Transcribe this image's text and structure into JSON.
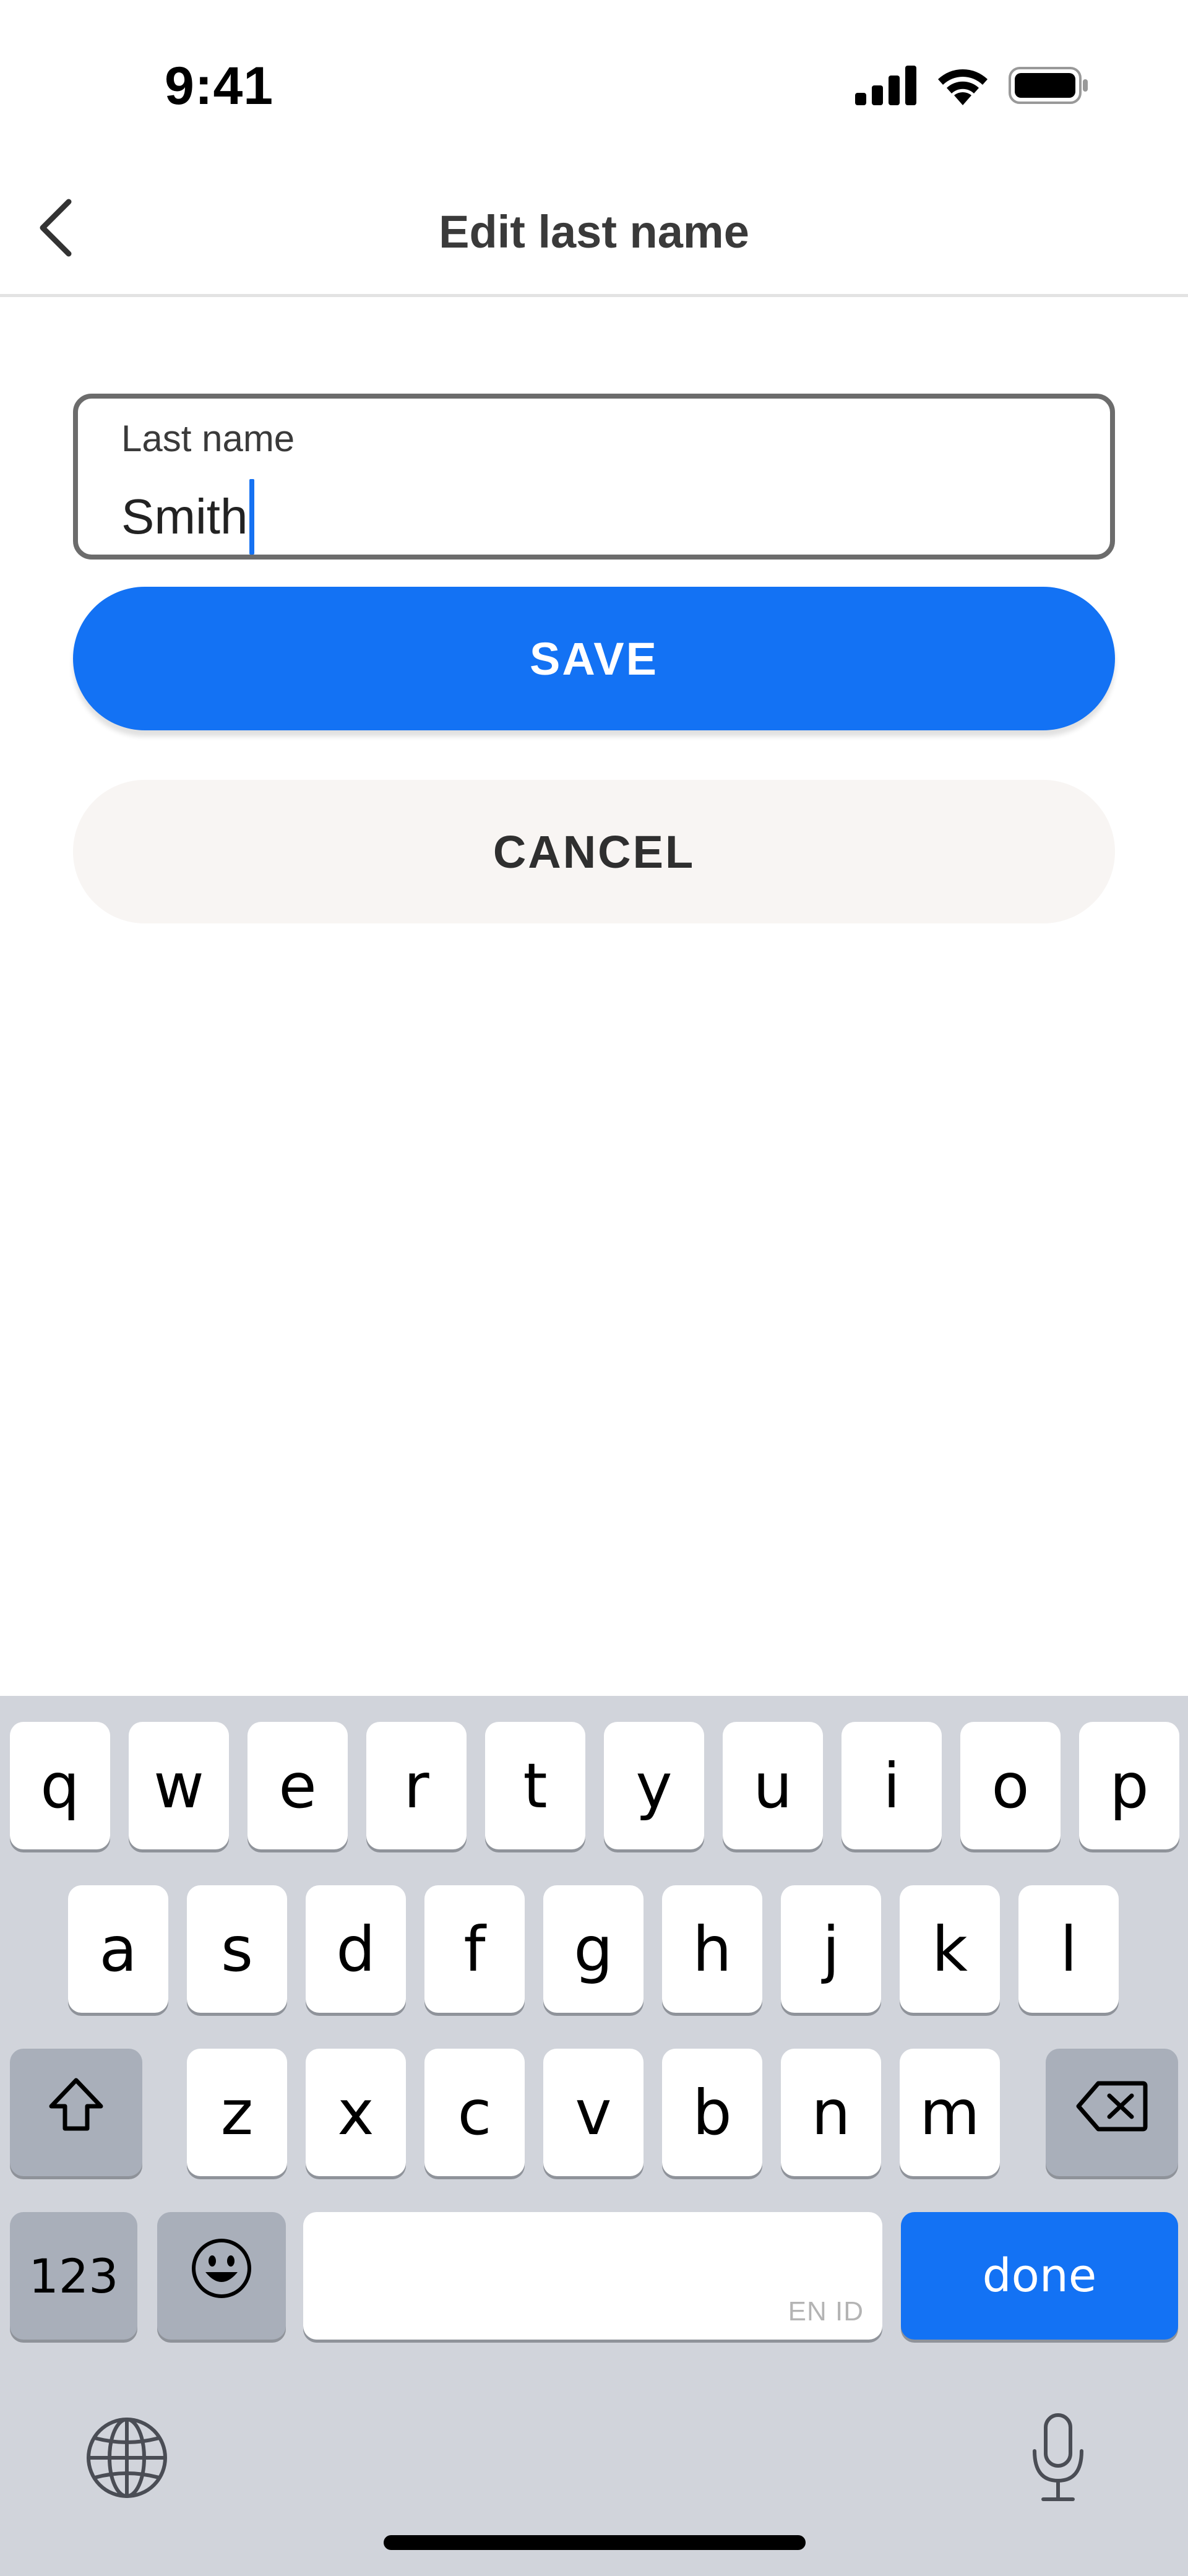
{
  "status_bar": {
    "time": "9:41",
    "icons": [
      "cellular-signal-icon",
      "wifi-icon",
      "battery-icon"
    ]
  },
  "header": {
    "title": "Edit last name",
    "back_icon": "chevron-left-icon"
  },
  "form": {
    "last_name_label": "Last name",
    "last_name_value": "Smith"
  },
  "actions": {
    "save_label": "SAVE",
    "cancel_label": "CANCEL"
  },
  "keyboard": {
    "row1": [
      "q",
      "w",
      "e",
      "r",
      "t",
      "y",
      "u",
      "i",
      "o",
      "p"
    ],
    "row2": [
      "a",
      "s",
      "d",
      "f",
      "g",
      "h",
      "j",
      "k",
      "l"
    ],
    "row3": [
      "z",
      "x",
      "c",
      "v",
      "b",
      "n",
      "m"
    ],
    "numbers_label": "123",
    "space_language_tag": "EN ID",
    "done_label": "done",
    "shift_icon": "shift-icon",
    "delete_icon": "backspace-icon",
    "emoji_icon": "emoji-icon",
    "globe_icon": "globe-icon",
    "mic_icon": "microphone-icon"
  },
  "colors": {
    "accent": "#1372f4",
    "cancel_background": "#f8f5f3",
    "keyboard_background": "#d1d4db",
    "caret": "#1672f2"
  }
}
